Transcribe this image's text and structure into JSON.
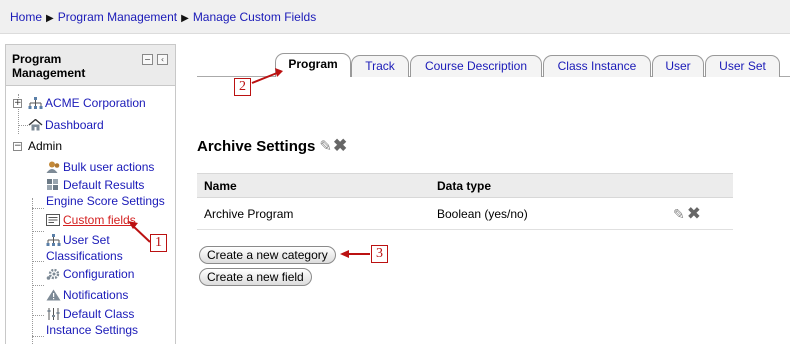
{
  "breadcrumb": {
    "items": [
      "Home",
      "Program Management",
      "Manage Custom Fields"
    ],
    "separator": "▶"
  },
  "sidebar": {
    "title": "Program Management",
    "header_icons": [
      "collapse-icon",
      "dock-icon"
    ],
    "tree": {
      "acme": "ACME Corporation",
      "dashboard": "Dashboard",
      "admin": "Admin",
      "bulk_user_actions": "Bulk user actions",
      "default_results_1": "Default Results",
      "default_results_2": "Engine Score Settings",
      "custom_fields": "Custom fields",
      "user_set_1": "User Set",
      "user_set_2": "Classifications",
      "configuration": "Configuration",
      "notifications": "Notifications",
      "default_class_1": "Default Class",
      "default_class_2": "Instance Settings"
    }
  },
  "tabs": [
    "Program",
    "Track",
    "Course Description",
    "Class Instance",
    "User",
    "User Set"
  ],
  "active_tab": "Program",
  "section": {
    "title": "Archive Settings",
    "edit_icon": "pencil-icon",
    "delete_icon": "x-icon"
  },
  "table": {
    "headers": [
      "Name",
      "Data type"
    ],
    "rows": [
      {
        "name": "Archive Program",
        "data_type": "Boolean (yes/no)"
      }
    ]
  },
  "buttons": {
    "new_category": "Create a new category",
    "new_field": "Create a new field"
  },
  "callouts": [
    "1",
    "2",
    "3"
  ],
  "colors": {
    "link": "#1a1ab8",
    "active_link": "#d42020",
    "callout": "#bb1111",
    "breadcrumb_bg": "#f0f0f0"
  }
}
